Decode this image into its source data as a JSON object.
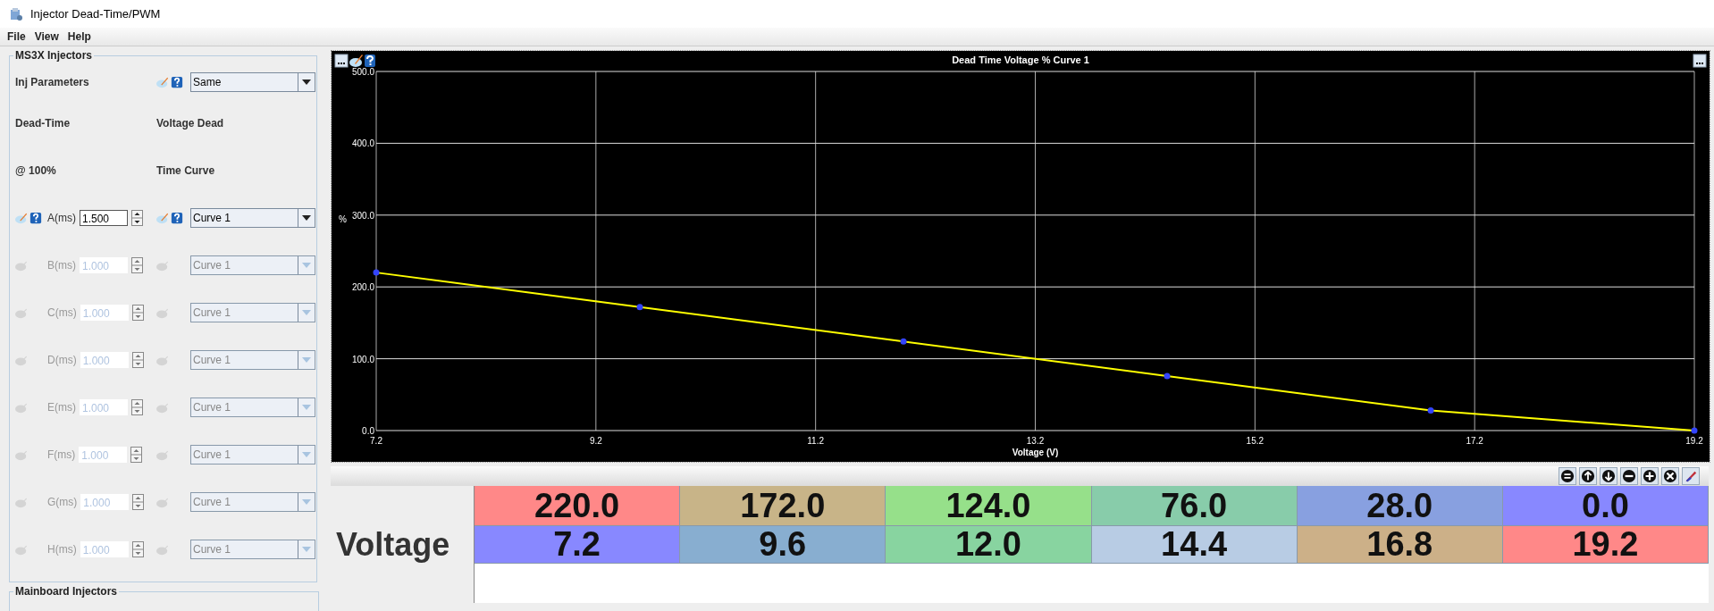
{
  "window": {
    "title": "Injector Dead-Time/PWM"
  },
  "menu": [
    {
      "label": "File"
    },
    {
      "label": "View"
    },
    {
      "label": "Help"
    }
  ],
  "left_panel": {
    "group_title": "MS3X Injectors",
    "inj_parameters": {
      "label": "Inj Parameters",
      "value": "Same"
    },
    "headings": [
      {
        "left": "Dead-Time",
        "right": "Voltage Dead"
      },
      {
        "left": "@ 100%",
        "right": "Time Curve"
      }
    ],
    "injectors": [
      {
        "label": "A(ms)",
        "value": "1.500",
        "curve": "Curve 1",
        "disabled": false
      },
      {
        "label": "B(ms)",
        "value": "1.000",
        "curve": "Curve 1",
        "disabled": true
      },
      {
        "label": "C(ms)",
        "value": "1.000",
        "curve": "Curve 1",
        "disabled": true
      },
      {
        "label": "D(ms)",
        "value": "1.000",
        "curve": "Curve 1",
        "disabled": true
      },
      {
        "label": "E(ms)",
        "value": "1.000",
        "curve": "Curve 1",
        "disabled": true
      },
      {
        "label": "F(ms)",
        "value": "1.000",
        "curve": "Curve 1",
        "disabled": true
      },
      {
        "label": "G(ms)",
        "value": "1.000",
        "curve": "Curve 1",
        "disabled": true
      },
      {
        "label": "H(ms)",
        "value": "1.000",
        "curve": "Curve 1",
        "disabled": true
      }
    ],
    "next_group_title": "Mainboard Injectors"
  },
  "chart": {
    "chart_data": {
      "type": "line",
      "title": "Dead Time Voltage % Curve 1",
      "xlabel": "Voltage (V)",
      "ylabel": "%",
      "x": [
        7.2,
        9.6,
        12.0,
        14.4,
        16.8,
        19.2
      ],
      "grid": true,
      "series": [
        {
          "color": "#ffff00",
          "marker": true,
          "values": [
            220.0,
            172.0,
            124.0,
            76.0,
            28.0,
            0.0
          ]
        }
      ],
      "xlim": [
        7.2,
        19.2
      ],
      "ylim": [
        0,
        500
      ],
      "xticks": [
        {
          "value": 7.2,
          "label": "7.2"
        },
        {
          "value": 9.2,
          "label": "9.2"
        },
        {
          "value": 11.2,
          "label": "11.2"
        },
        {
          "value": 13.2,
          "label": "13.2"
        },
        {
          "value": 15.2,
          "label": "15.2"
        },
        {
          "value": 17.2,
          "label": "17.2"
        },
        {
          "value": 19.2,
          "label": "19.2"
        }
      ],
      "yticks": [
        {
          "value": 0,
          "label": "0.0"
        },
        {
          "value": 100,
          "label": "100.0"
        },
        {
          "value": 200,
          "label": "200.0"
        },
        {
          "value": 300,
          "label": "300.0"
        },
        {
          "value": 400,
          "label": "400.0"
        },
        {
          "value": 500,
          "label": "500.0"
        }
      ]
    }
  },
  "table": {
    "toolbar": [
      {
        "kind": "equals"
      },
      {
        "kind": "up"
      },
      {
        "kind": "down"
      },
      {
        "kind": "minus"
      },
      {
        "kind": "plus"
      },
      {
        "kind": "close"
      },
      {
        "kind": "pen"
      }
    ],
    "rows": [
      {
        "cells": [
          {
            "value": "220.0",
            "color": "#ff8888"
          },
          {
            "value": "172.0",
            "color": "#c8b488"
          },
          {
            "value": "124.0",
            "color": "#96e08a"
          },
          {
            "value": "76.0",
            "color": "#88ccaa"
          },
          {
            "value": "28.0",
            "color": "#88a0e0"
          },
          {
            "value": "0.0",
            "color": "#8888ff"
          }
        ]
      },
      {
        "label": "Voltage",
        "cells": [
          {
            "value": "7.2",
            "color": "#8888ff"
          },
          {
            "value": "9.6",
            "color": "#88aed0"
          },
          {
            "value": "12.0",
            "color": "#88d4a0"
          },
          {
            "value": "14.4",
            "color": "#b8cce4"
          },
          {
            "value": "16.8",
            "color": "#ccb088"
          },
          {
            "value": "19.2",
            "color": "#ff8888"
          }
        ]
      }
    ]
  }
}
